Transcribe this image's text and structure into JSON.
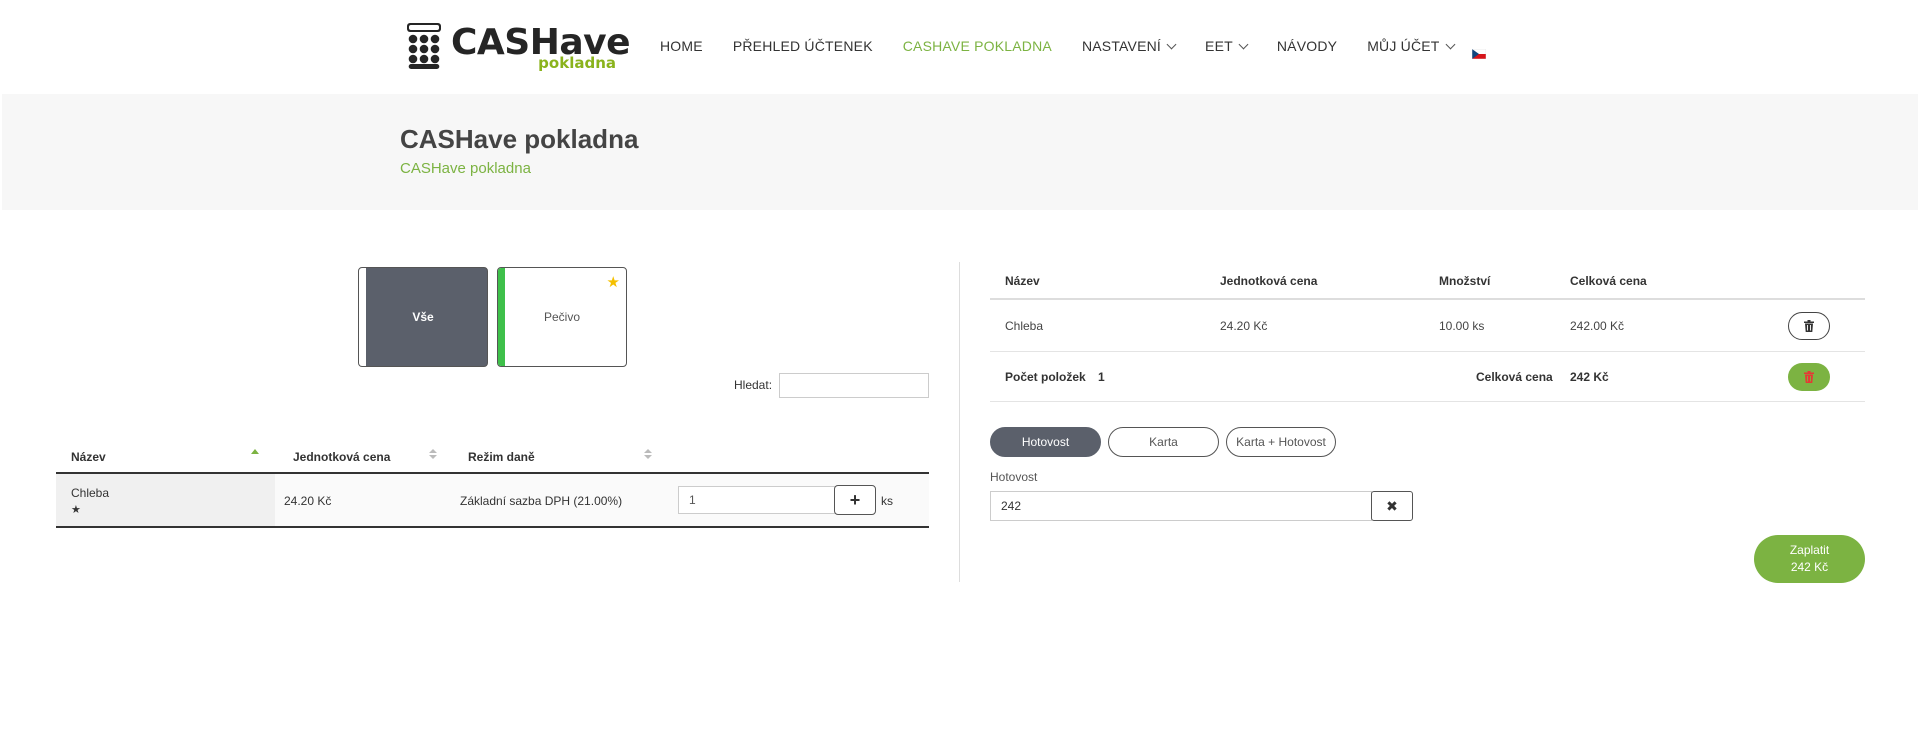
{
  "header": {
    "logo_main": "CASHave",
    "logo_sub": "pokladna",
    "nav": [
      {
        "label": "HOME",
        "active": false,
        "dropdown": false
      },
      {
        "label": "PŘEHLED ÚČTENEK",
        "active": false,
        "dropdown": false
      },
      {
        "label": "CASHAVE POKLADNA",
        "active": true,
        "dropdown": false
      },
      {
        "label": "NASTAVENÍ",
        "active": false,
        "dropdown": true
      },
      {
        "label": "EET",
        "active": false,
        "dropdown": true
      },
      {
        "label": "NÁVODY",
        "active": false,
        "dropdown": false
      },
      {
        "label": "MŮJ ÚČET",
        "active": false,
        "dropdown": true
      }
    ],
    "language_icon": "czech-flag-icon"
  },
  "title_band": {
    "title": "CASHave pokladna",
    "breadcrumb": "CASHave pokladna"
  },
  "categories": [
    {
      "label": "Vše",
      "selected": true
    },
    {
      "label": "Pečivo",
      "selected": false,
      "favorite": true,
      "color": "#3ec04a"
    }
  ],
  "search": {
    "label": "Hledat:",
    "value": ""
  },
  "products": {
    "columns": [
      "Název",
      "Jednotková cena",
      "Režim daně"
    ],
    "rows": [
      {
        "name": "Chleba",
        "star": "★",
        "price": "24.20 Kč",
        "tax": "Základní sazba DPH (21.00%)",
        "qty": "1",
        "unit": "ks"
      }
    ]
  },
  "cart": {
    "columns": [
      "Název",
      "Jednotková cena",
      "Množství",
      "Celková cena"
    ],
    "rows": [
      {
        "name": "Chleba",
        "price": "24.20 Kč",
        "qty": "10.00 ks",
        "total": "242.00 Kč"
      }
    ],
    "summary": {
      "count_label": "Počet položek",
      "count": "1",
      "total_label": "Celková cena",
      "total": "242 Kč"
    }
  },
  "payment": {
    "methods": [
      "Hotovost",
      "Karta",
      "Karta + Hotovost"
    ],
    "selected": "Hotovost",
    "cash_label": "Hotovost",
    "cash_value": "242",
    "pay_label": "Zaplatit",
    "pay_amount": "242 Kč"
  },
  "colors": {
    "accent": "#7cb342",
    "dark": "#5b606b"
  }
}
